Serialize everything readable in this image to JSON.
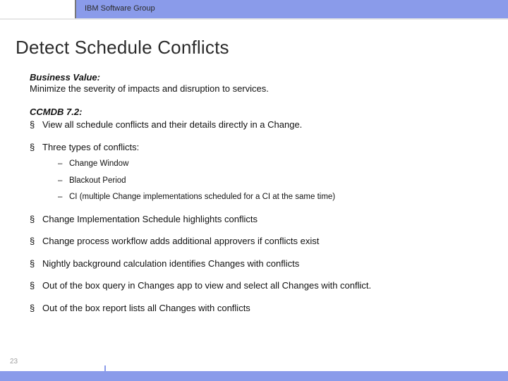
{
  "header": {
    "group": "IBM Software Group"
  },
  "title": "Detect Schedule Conflicts",
  "business_value": {
    "label": "Business Value:",
    "text": "Minimize the severity of impacts and disruption to services."
  },
  "ccmdb": {
    "label": "CCMDB 7.2:",
    "bullets": [
      "View all schedule conflicts and their details directly in a Change.",
      "Three types of conflicts:",
      "Change Implementation Schedule highlights conflicts",
      "Change process workflow adds additional approvers if conflicts exist",
      "Nightly background calculation identifies Changes with conflicts",
      "Out of the box query in Changes app to view and select all Changes with conflict.",
      "Out of the box report lists all Changes with conflicts"
    ],
    "sub_bullets": [
      "Change Window",
      "Blackout Period",
      "CI  (multiple Change implementations scheduled for a CI at the same time)"
    ]
  },
  "page_number": "23"
}
